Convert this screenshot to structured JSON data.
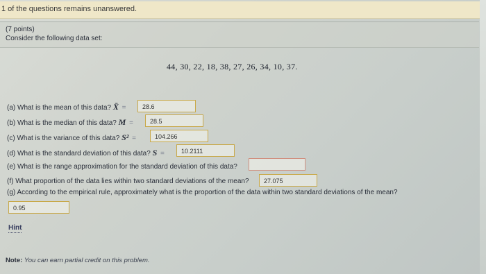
{
  "status": "1 of the questions remains unanswered.",
  "points": "(7 points)",
  "prompt": "Consider the following data set:",
  "dataset": "44, 30, 22, 18, 38, 27, 26, 34, 10, 37.",
  "questions": {
    "a": {
      "text": "(a) What is the mean of this data?",
      "symbol": "X̄",
      "answer": "28.6"
    },
    "b": {
      "text": "(b) What is the median of this data?",
      "symbol": "M",
      "answer": "28.5"
    },
    "c": {
      "text": "(c) What is the variance of this data?",
      "symbol": "S²",
      "answer": "104.266"
    },
    "d": {
      "text": "(d) What is the standard deviation of this data?",
      "symbol": "S",
      "answer": "10.2111"
    },
    "e": {
      "text": "(e) What is the range approximation for the standard deviation of this data?",
      "answer": ""
    },
    "f": {
      "text": "(f) What proportion of the data lies within two standard deviations of the mean?",
      "answer": "27.075"
    },
    "g": {
      "text": "(g) According to the empirical rule, approximately what is the proportion of the data within two standard deviations of the mean?",
      "answer": "0.95"
    }
  },
  "hint": "Hint",
  "note": {
    "label": "Note:",
    "text": "You can earn partial credit on this problem."
  },
  "eq_sign": "="
}
